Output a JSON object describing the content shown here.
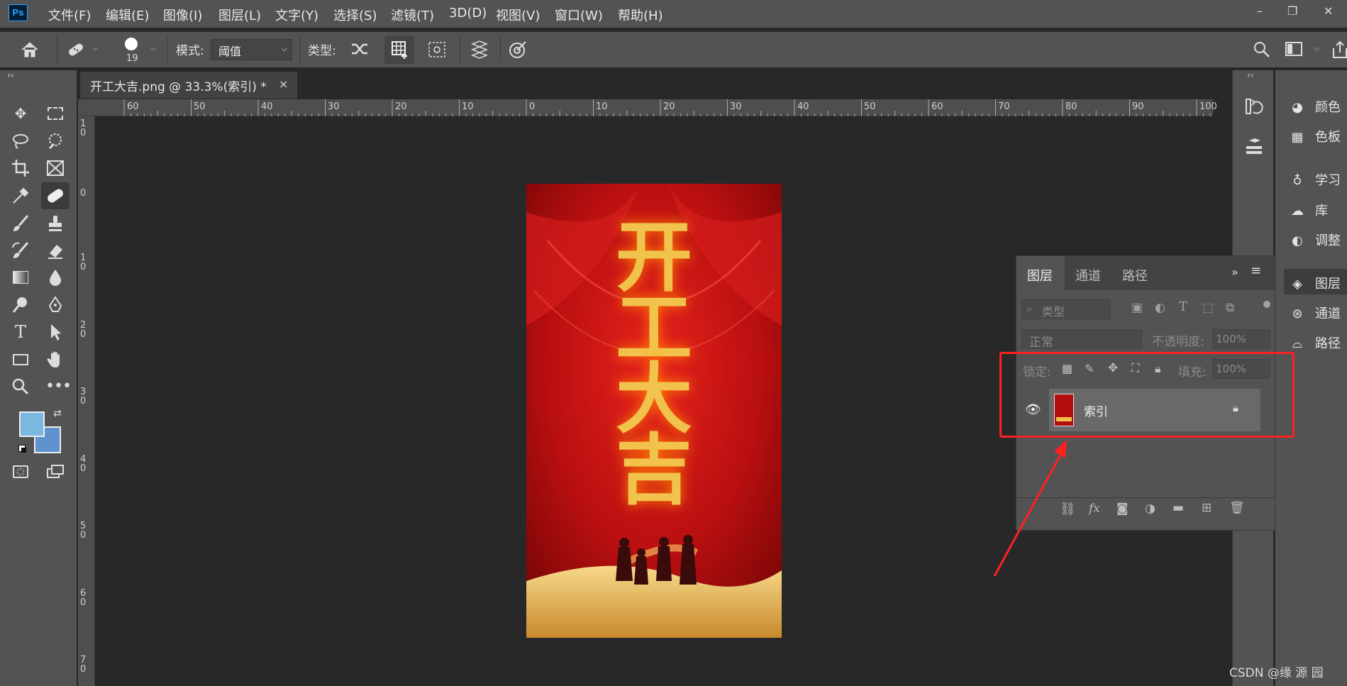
{
  "app": {
    "logo": "Ps"
  },
  "menu": [
    "文件(F)",
    "编辑(E)",
    "图像(I)",
    "图层(L)",
    "文字(Y)",
    "选择(S)",
    "滤镜(T)",
    "3D(D)",
    "视图(V)",
    "窗口(W)",
    "帮助(H)"
  ],
  "window_controls": {
    "minimize": "–",
    "restore": "❐",
    "close": "✕"
  },
  "options_bar": {
    "brush_size": "19",
    "mode_label": "模式:",
    "mode_value": "阈值",
    "type_label": "类型:"
  },
  "document": {
    "tab_title": "开工大吉.png @ 33.3%(索引) *",
    "close": "×",
    "image_chars": [
      "开",
      "工",
      "大",
      "吉"
    ]
  },
  "ruler_top_labels": [
    "60",
    "50",
    "40",
    "30",
    "20",
    "10",
    "0",
    "10",
    "20",
    "30",
    "40",
    "50",
    "60",
    "70",
    "80",
    "90",
    "100"
  ],
  "ruler_left_labels": [
    "1 0",
    "0",
    "1 0",
    "2 0",
    "3 0",
    "4 0",
    "5 0",
    "6 0",
    "7 0"
  ],
  "right_panel": {
    "items": [
      {
        "icon": "palette-icon",
        "label": "颜色"
      },
      {
        "icon": "grid-icon",
        "label": "色板"
      },
      {
        "icon": "bulb-icon",
        "label": "学习"
      },
      {
        "icon": "cloud-icon",
        "label": "库"
      },
      {
        "icon": "adjust-icon",
        "label": "调整"
      },
      {
        "icon": "layers-icon",
        "label": "图层"
      },
      {
        "icon": "channels-icon",
        "label": "通道"
      },
      {
        "icon": "path-icon",
        "label": "路径"
      }
    ]
  },
  "layers_panel": {
    "tabs": [
      "图层",
      "通道",
      "路径"
    ],
    "active_tab": "图层",
    "filter_placeholder": "类型",
    "blend_mode": "正常",
    "opacity_label": "不透明度:",
    "opacity_value": "100%",
    "lock_label": "锁定:",
    "fill_label": "填充:",
    "fill_value": "100%",
    "layers": [
      {
        "name": "索引",
        "visible": true,
        "locked": true
      }
    ]
  },
  "annotation_color": "#ff2020",
  "watermark": "CSDN @缘 源 园",
  "colors": {
    "foreground": "#7bb8df",
    "background": "#5f93cf",
    "image_red": "#b30d0d",
    "gold": "#f2c34c"
  }
}
